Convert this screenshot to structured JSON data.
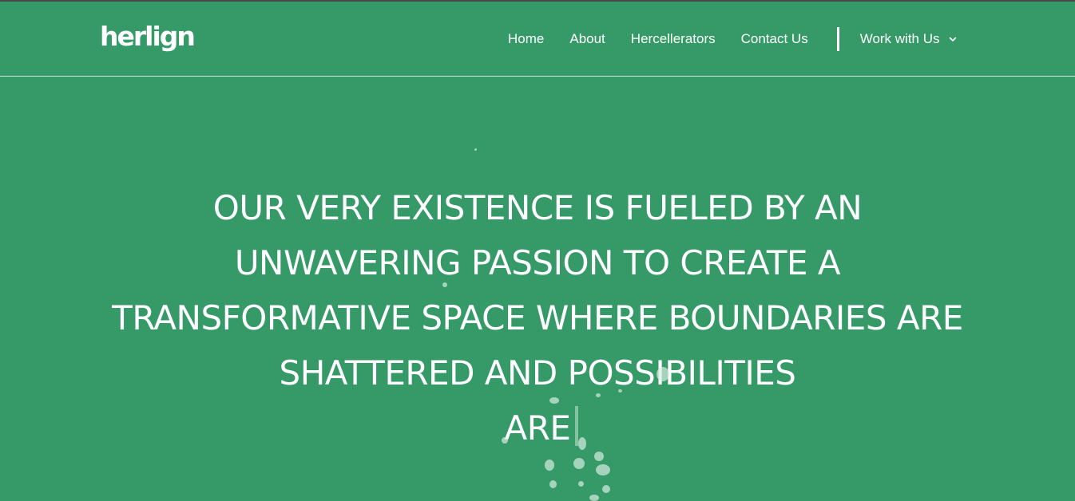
{
  "header": {
    "logo_text": "herlign",
    "nav": {
      "items": [
        "Home",
        "About",
        "Hercellerators",
        "Contact Us"
      ],
      "work_with_us": "Work with Us"
    }
  },
  "hero": {
    "lines": [
      "OUR VERY EXISTENCE IS FUELED BY AN",
      "UNWAVERING PASSION TO CREATE A",
      "TRANSFORMATIVE SPACE WHERE BOUNDARIES ARE",
      "SHATTERED AND POSSIBILITIES",
      "ARE"
    ]
  },
  "icons": {
    "dropdown": "chevron-down-icon"
  },
  "colors": {
    "background": "#359a68",
    "text": "#ffffff"
  }
}
